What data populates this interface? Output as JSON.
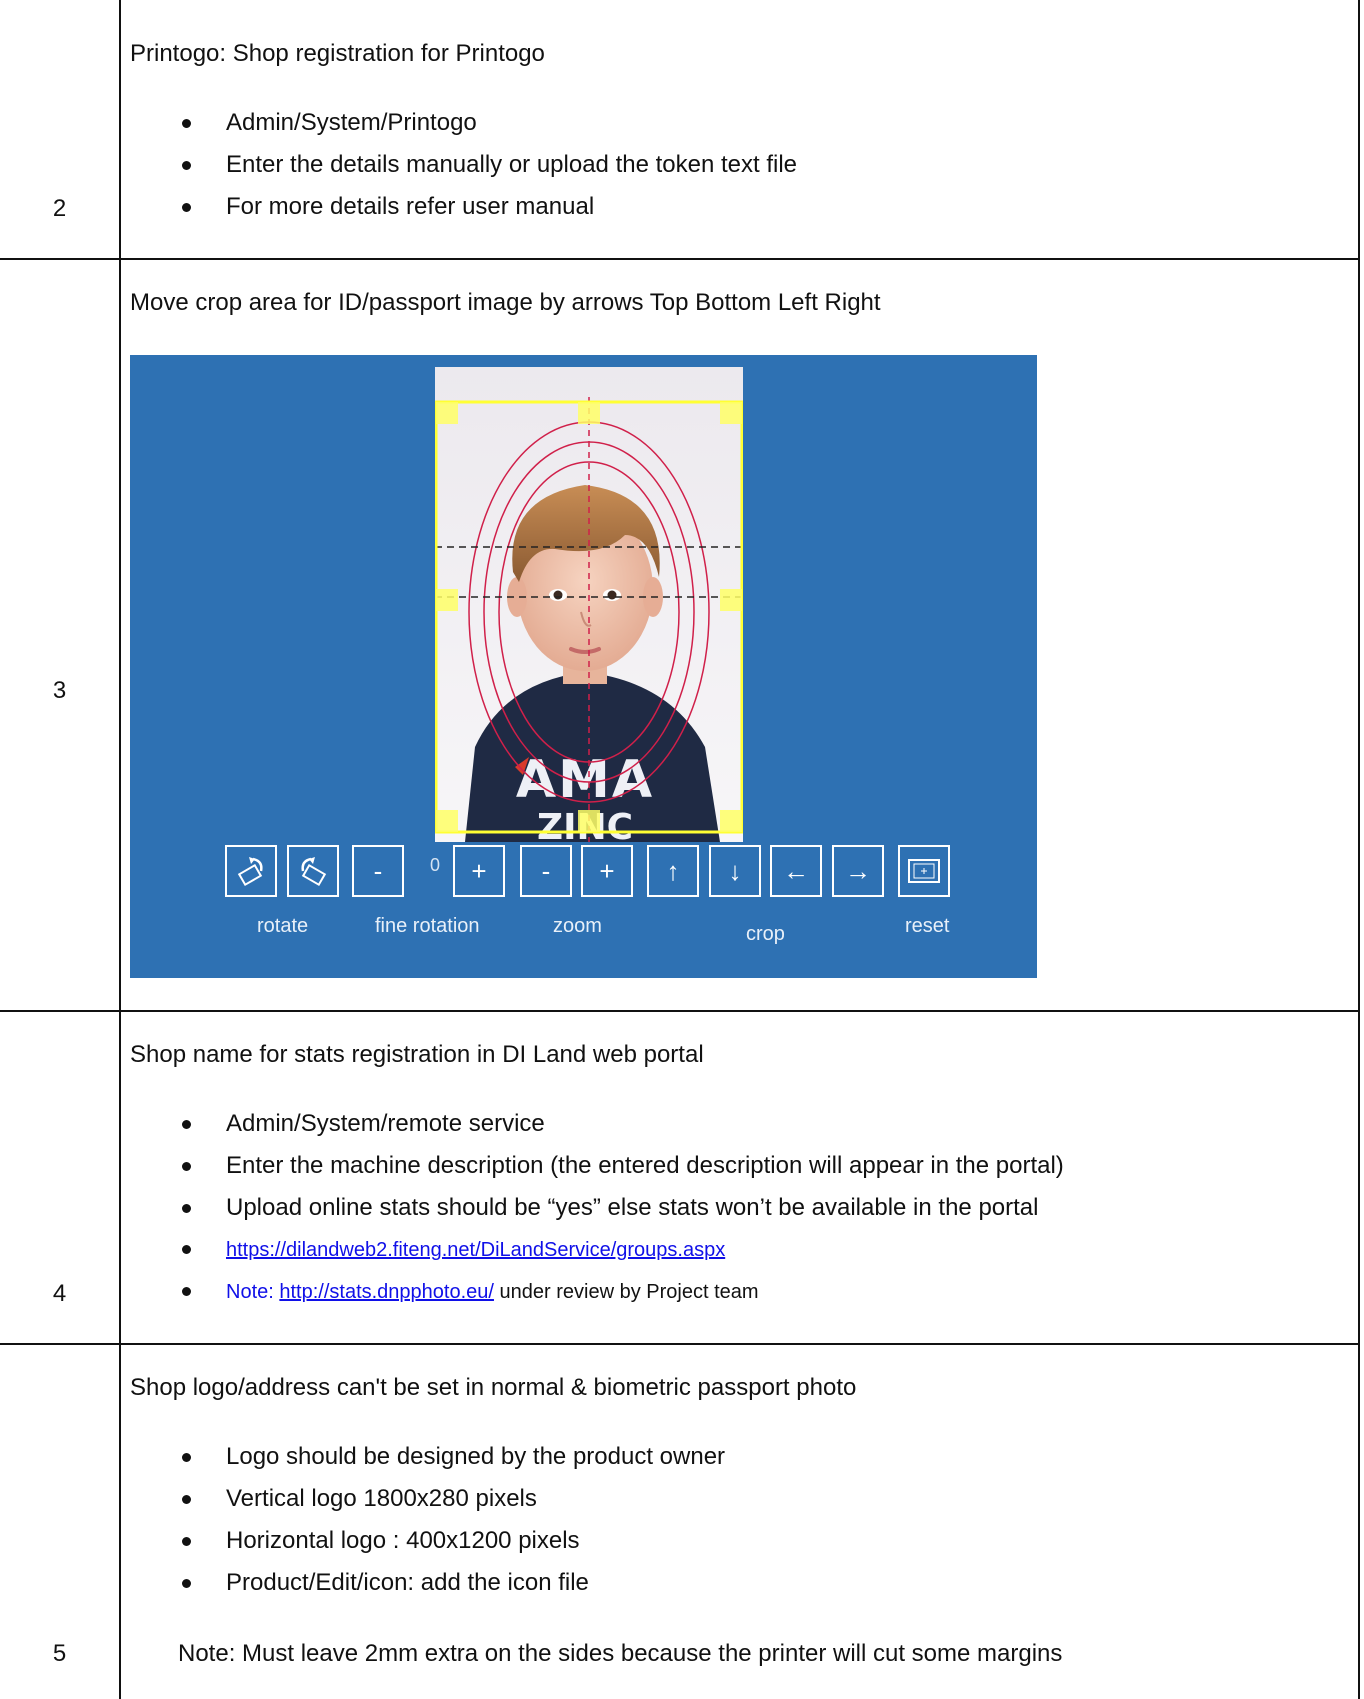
{
  "rows": [
    {
      "number": "2",
      "heading": "Printogo: Shop registration for Printogo",
      "bullets": [
        "Admin/System/Printogo",
        "Enter the details manually or upload the token text file",
        "For more details refer user manual"
      ]
    },
    {
      "number": "3",
      "heading": "Move crop area for ID/passport image by arrows Top Bottom Left Right",
      "editor": {
        "fine_rotation_value": "0",
        "labels": {
          "rotate": "rotate",
          "fine_rotation": "fine rotation",
          "zoom": "zoom",
          "crop": "crop",
          "reset": "reset"
        },
        "buttons": {
          "minus": "-",
          "plus": "+",
          "up": "↑",
          "down": "↓",
          "left": "←",
          "right": "→"
        },
        "colors": {
          "panel": "#2e71b3",
          "crop_frame": "#ffff33",
          "guide_ellipse": "#d0204a"
        }
      }
    },
    {
      "number": "4",
      "heading": "Shop name for stats registration in DI Land web portal",
      "bullets": [
        "Admin/System/remote service",
        "Enter the machine description (the entered description will appear in the portal)",
        "Upload online stats should be “yes” else stats won’t be available in the portal"
      ],
      "link": "https://dilandweb2.fiteng.net/DiLandService/groups.aspx",
      "note": {
        "prefix": "Note: ",
        "link": "http://stats.dnpphoto.eu/",
        "suffix": " under review by Project team"
      }
    },
    {
      "number": "5",
      "heading": "Shop logo/address can't be set in normal & biometric passport photo",
      "bullets": [
        "Logo should be designed by the product owner",
        "Vertical logo 1800x280 pixels",
        "Horizontal logo : 400x1200 pixels",
        "Product/Edit/icon: add the icon file"
      ],
      "footnote": "Note: Must leave 2mm extra on the sides because the printer will cut some margins"
    }
  ]
}
